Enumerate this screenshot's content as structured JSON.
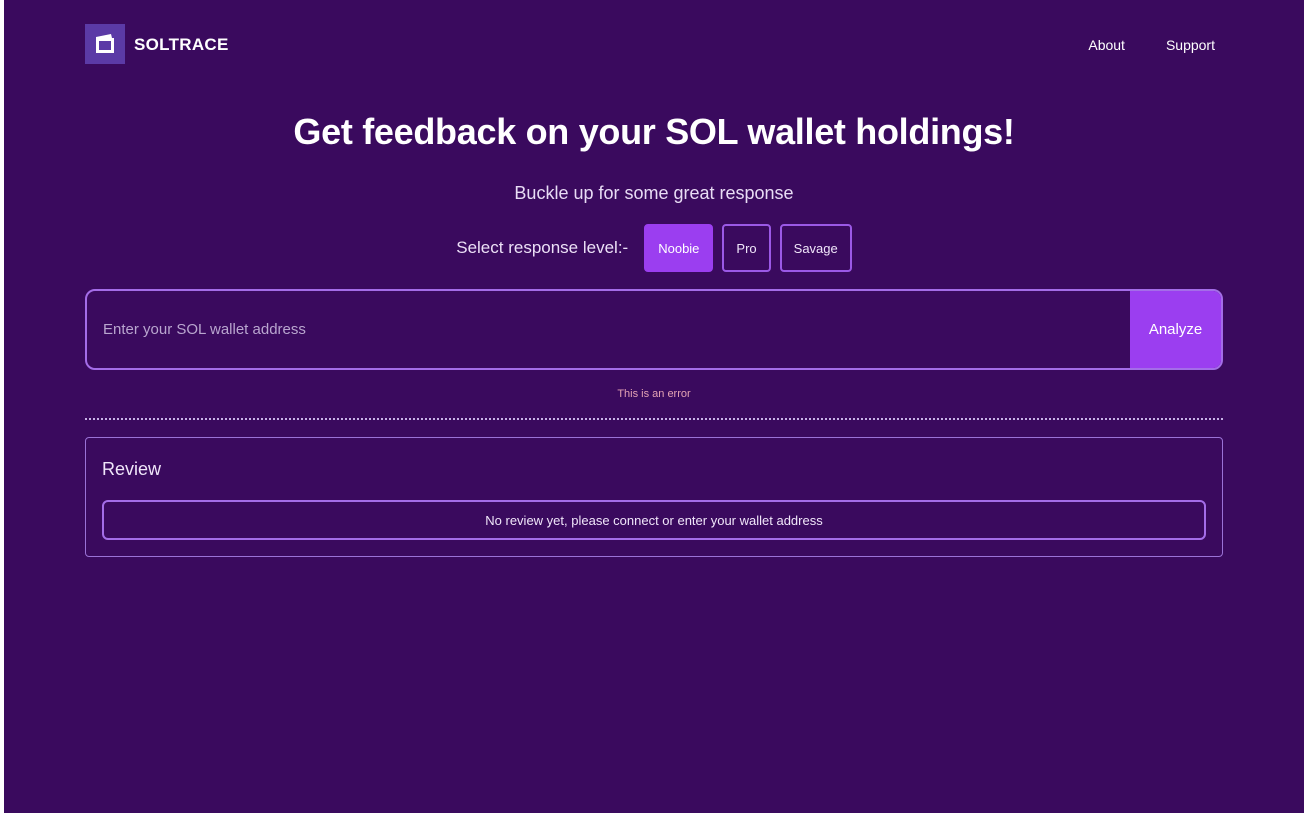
{
  "header": {
    "brand": "SOLTRACE",
    "nav": [
      "About",
      "Support"
    ],
    "logo_icon": "wallet-icon"
  },
  "hero": {
    "title": "Get feedback on your SOL wallet holdings!",
    "subtitle": "Buckle up for some great response"
  },
  "level": {
    "label": "Select response level:-",
    "options": [
      "Noobie",
      "Pro",
      "Savage"
    ],
    "selected": "Noobie"
  },
  "wallet": {
    "placeholder": "Enter your SOL wallet address",
    "value": "",
    "button": "Analyze"
  },
  "error": "This is an error",
  "review": {
    "title": "Review",
    "empty_text": "No review yet, please connect or enter your wallet address"
  },
  "colors": {
    "background": "#3a0a5e",
    "accent": "#9b3ef0",
    "border": "#a46de8",
    "error": "#e3a2b4"
  }
}
